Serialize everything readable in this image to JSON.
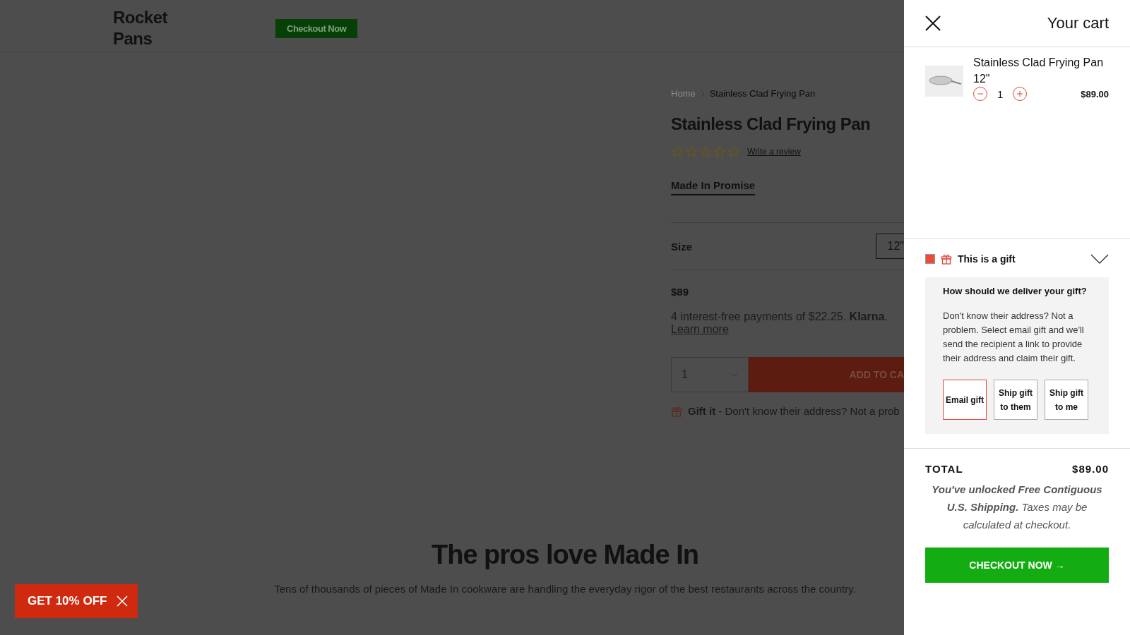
{
  "header": {
    "logo": "Rocket Pans",
    "checkout_button": "Checkout Now"
  },
  "product": {
    "breadcrumb": [
      "Home",
      "Stainless Clad Frying Pan"
    ],
    "title": "Stainless Clad Frying Pan",
    "stars": 0,
    "review_link": "Write a review",
    "promise_tab": "Made In Promise",
    "size_label": "Size",
    "size_value": "12\"",
    "price": "$89",
    "installments": "4 interest-free payments of $22.25. **Klarna**.",
    "learn_more": "Learn more",
    "quantity": "1",
    "add_button": "ADD TO CA",
    "gift_note": "**Gift it** - Don't know their address? Not a prob"
  },
  "pros": {
    "title": "The pros love Made In",
    "text": "Tens of thousands of pieces of Made In cookware are handling the everyday rigor of the best restaurants across the country."
  },
  "promo": {
    "label": "GET 10% OFF"
  },
  "cart": {
    "title": "Your cart",
    "items": [
      {
        "name": "Stainless Clad Frying Pan",
        "variant": "12\"",
        "quantity": "1",
        "price": "$89.00"
      }
    ],
    "gift": {
      "checked": true,
      "expanded": true,
      "label": "This is a gift",
      "question": "How should we deliver your gift?",
      "text": "Don't know their address? Not a problem. Select email gift and we'll send the recipient a link to provide their address and claim their gift.",
      "options": [
        {
          "label": "Email gift",
          "selected": true
        },
        {
          "label": "Ship gift to them",
          "selected": false
        },
        {
          "label": "Ship gift to me",
          "selected": false
        }
      ]
    },
    "total_label": "TOTAL",
    "total": "$89.00",
    "shipping_note": "**You've unlocked Free Contiguous U.S. Shipping.** Taxes may be calculated at checkout.",
    "checkout_button": "CHECKOUT NOW →"
  }
}
